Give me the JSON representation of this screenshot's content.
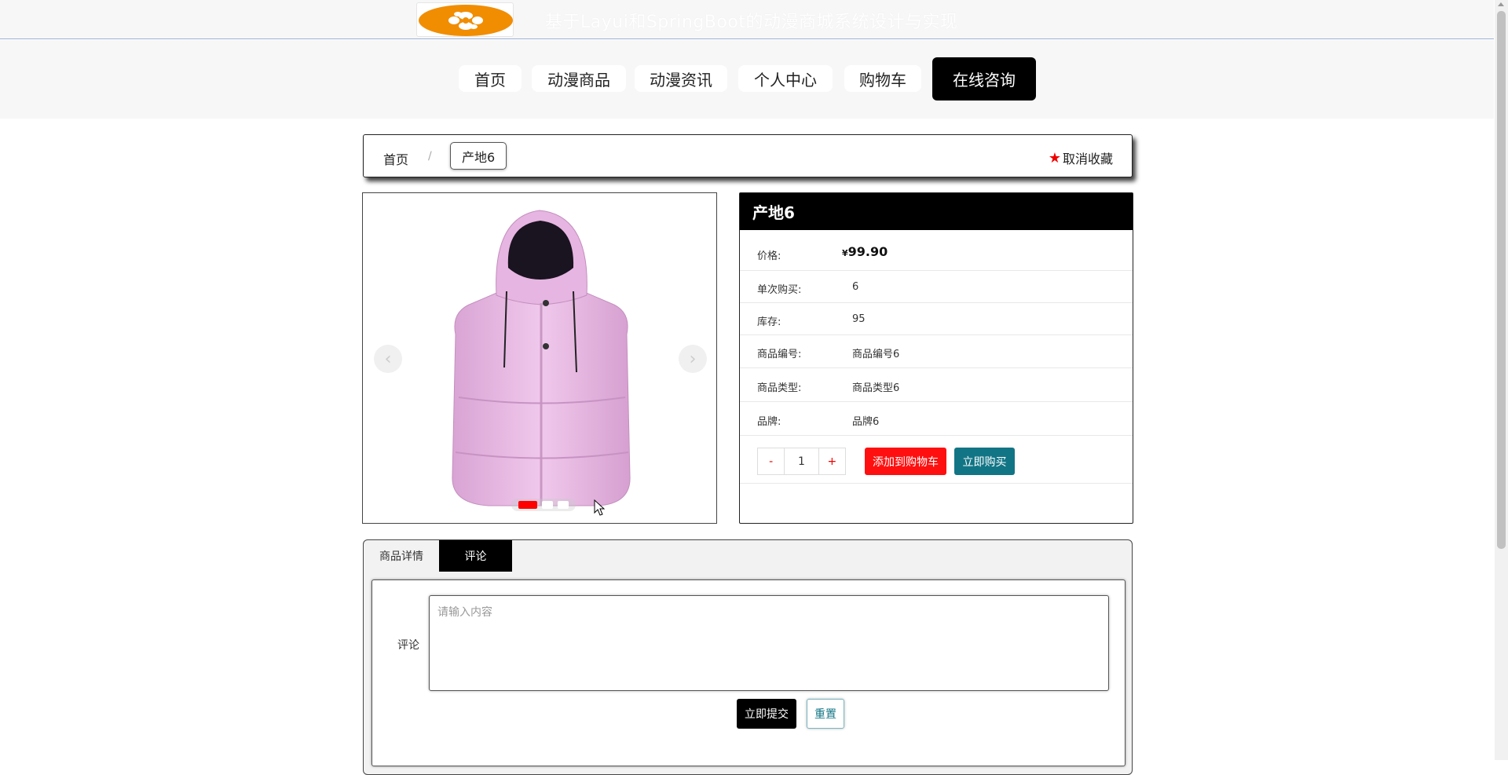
{
  "header": {
    "site_title": "基于Layui和SpringBoot的动漫商城系统设计与实现",
    "logo": "flower-logo"
  },
  "nav": {
    "items": [
      {
        "label": "首页"
      },
      {
        "label": "动漫商品"
      },
      {
        "label": "动漫资讯"
      },
      {
        "label": "个人中心"
      },
      {
        "label": "购物车"
      },
      {
        "label": "在线咨询",
        "active": true
      }
    ]
  },
  "breadcrumb": {
    "home": "首页",
    "separator": "/",
    "current": "产地6",
    "favorite_label": "取消收藏",
    "favorite_icon": "star-icon",
    "favorite_icon_color": "#ee0000"
  },
  "carousel": {
    "prev_icon": "chevron-left-icon",
    "next_icon": "chevron-right-icon",
    "image": "pink-puffer-vest-photo",
    "slide_count": 3,
    "active_slide": 1
  },
  "product": {
    "title": "产地6",
    "price_label": "价格:",
    "currency": "¥",
    "price": "99.90",
    "fields": [
      {
        "label": "单次购买:",
        "value": "6"
      },
      {
        "label": "库存:",
        "value": "95"
      },
      {
        "label": "商品编号:",
        "value": "商品编号6"
      },
      {
        "label": "商品类型:",
        "value": "商品类型6"
      },
      {
        "label": "品牌:",
        "value": "品牌6"
      }
    ],
    "quantity": {
      "minus": "-",
      "value": "1",
      "plus": "+"
    },
    "add_to_cart": "添加到购物车",
    "buy_now": "立即购买"
  },
  "tabs": {
    "items": [
      {
        "label": "商品详情"
      },
      {
        "label": "评论",
        "active": true
      }
    ],
    "comment": {
      "label": "评论",
      "placeholder": "请输入内容",
      "submit": "立即提交",
      "reset": "重置"
    }
  },
  "colors": {
    "accent_black": "#000000",
    "cart_red": "#ff1010",
    "buy_teal": "#127585",
    "logo_orange": "#f18d00"
  }
}
